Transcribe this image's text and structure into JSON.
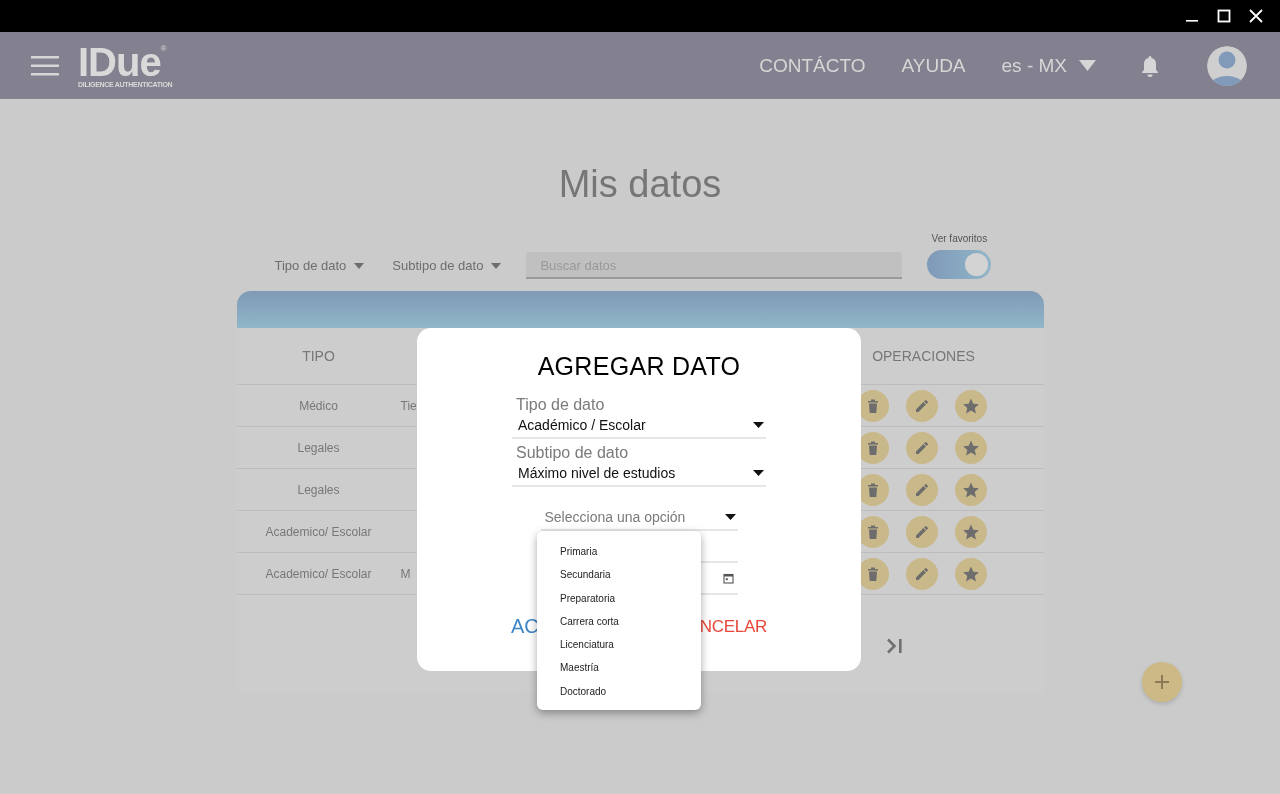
{
  "header": {
    "logo": {
      "name": "IDue",
      "mark": "®",
      "tagline": "DILIGENCE AUTHENTICATION"
    },
    "nav": [
      "CONTÁCTO",
      "AYUDA"
    ],
    "language": "es - MX"
  },
  "page_title": "Mis datos",
  "filters": {
    "dropdowns": [
      "Tipo de dato",
      "Subtipo de dato"
    ],
    "search": {
      "placeholder": "Buscar datos"
    },
    "favorites_toggle": {
      "label": "Ver favoritos",
      "on": true
    }
  },
  "table": {
    "columns": [
      {
        "label": "TIPO"
      },
      {
        "label": "OPERACIONES"
      }
    ],
    "rows": [
      {
        "column_1": "Médico",
        "column_2": "Tie"
      },
      {
        "column_1": "Legales"
      },
      {
        "column_1": "Legales"
      },
      {
        "column_1": "Academico/ Escolar"
      },
      {
        "column_1": "Academico/ Escolar",
        "column_2": "M"
      }
    ]
  },
  "dialog": {
    "title": "AGREGAR DATO",
    "fields": [
      {
        "kind": "select",
        "label": "Tipo de dato",
        "value": "Académico / Escolar"
      },
      {
        "kind": "select",
        "label": "Subtipo de dato",
        "value": "Máximo nivel de estudios"
      },
      {
        "kind": "select",
        "placeholder": "Selecciona una opción"
      },
      {
        "kind": "text"
      },
      {
        "kind": "date"
      }
    ],
    "buttons": [
      {
        "kind": "accept",
        "label": "AC"
      },
      {
        "kind": "cancel",
        "label": "NCELAR"
      }
    ]
  },
  "dropdown_menu": {
    "options": [
      "Primaria",
      "Secundaria",
      "Preparatoria",
      "Carrera corta",
      "Licenciatura",
      "Maestría",
      "Doctorado"
    ]
  }
}
